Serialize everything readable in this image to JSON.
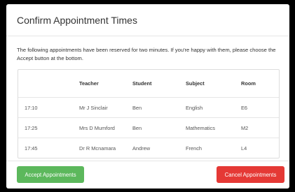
{
  "modal": {
    "title": "Confirm Appointment Times",
    "intro": "The following appointments have been reserved for two minutes. If you're happy with them, please choose the Accept button at the bottom."
  },
  "table": {
    "columns": [
      "",
      "Teacher",
      "Student",
      "Subject",
      "Room"
    ],
    "rows": [
      {
        "time": "17:10",
        "teacher": "Mr J Sinclair",
        "student": "Ben",
        "subject": "English",
        "room": "E6"
      },
      {
        "time": "17:25",
        "teacher": "Mrs D Mumford",
        "student": "Ben",
        "subject": "Mathematics",
        "room": "M2"
      },
      {
        "time": "17:45",
        "teacher": "Dr R Mcnamara",
        "student": "Andrew",
        "subject": "French",
        "room": "L4"
      }
    ]
  },
  "footer": {
    "accept_label": "Accept Appointments",
    "cancel_label": "Cancel Appointments"
  },
  "colors": {
    "accept": "#5cb85c",
    "cancel": "#e53935",
    "backdrop": "#000000"
  }
}
